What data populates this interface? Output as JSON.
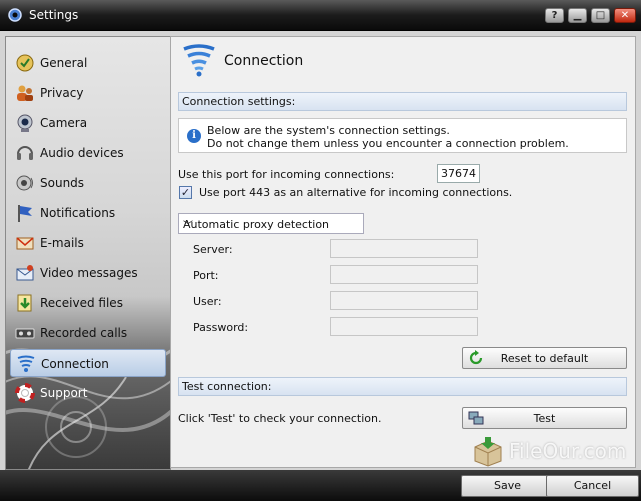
{
  "window": {
    "title": "Settings"
  },
  "titlebar": {
    "help": "?",
    "minimize": "▁",
    "maximize": "□",
    "close": "✕"
  },
  "sidebar": {
    "items": [
      {
        "label": "General",
        "icon": "general-icon"
      },
      {
        "label": "Privacy",
        "icon": "privacy-icon"
      },
      {
        "label": "Camera",
        "icon": "camera-icon"
      },
      {
        "label": "Audio devices",
        "icon": "audio-devices-icon"
      },
      {
        "label": "Sounds",
        "icon": "sounds-icon"
      },
      {
        "label": "Notifications",
        "icon": "notifications-icon"
      },
      {
        "label": "E-mails",
        "icon": "emails-icon"
      },
      {
        "label": "Video messages",
        "icon": "video-messages-icon"
      },
      {
        "label": "Received files",
        "icon": "received-files-icon"
      },
      {
        "label": "Recorded calls",
        "icon": "recorded-calls-icon"
      },
      {
        "label": "Connection",
        "icon": "connection-icon",
        "active": true
      },
      {
        "label": "Support",
        "icon": "support-icon"
      }
    ]
  },
  "main": {
    "title": "Connection",
    "section_connection": "Connection settings:",
    "info_line1": "Below are the system's connection settings.",
    "info_line2": "Do not change them unless you encounter a connection problem.",
    "port_label": "Use this port for incoming connections:",
    "port_value": "37674",
    "use443_label": "Use port 443 as an alternative for incoming connections.",
    "use443_checked": true,
    "proxy_selected": "Automatic proxy detection",
    "server_label": "Server:",
    "port_field_label": "Port:",
    "user_label": "User:",
    "password_label": "Password:",
    "reset_label": "Reset to default",
    "section_test": "Test connection:",
    "test_hint": "Click 'Test' to check your connection.",
    "test_label": "Test",
    "watermark": "FileOur.com"
  },
  "footer": {
    "save": "Save",
    "cancel": "Cancel"
  },
  "colors": {
    "accent": "#2a6fc9",
    "active_item": "#b9cde6"
  }
}
